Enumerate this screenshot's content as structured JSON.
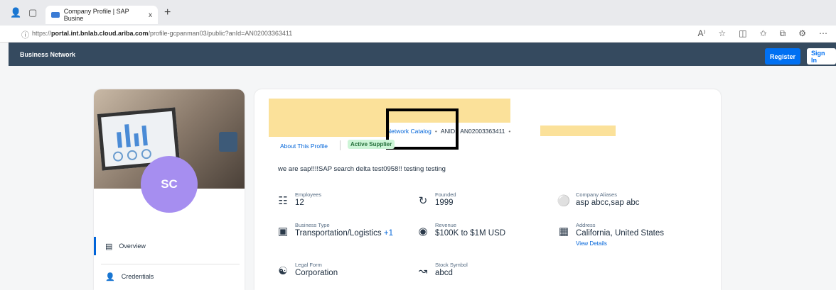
{
  "browser": {
    "tab_title": "Company Profile | SAP Busine",
    "tab_close": "x",
    "new_tab": "+",
    "url_prefix": "https://",
    "url_host": "portal.int.bnlab.cloud.ariba.com",
    "url_path": "/profile-gcpanman03/public?anId=AN02003363411",
    "icons": [
      "read-aloud-icon",
      "favorite-icon",
      "split-screen-icon",
      "favorites-bar-icon",
      "collections-icon",
      "extensions-icon",
      "more-icon"
    ]
  },
  "header": {
    "brand": "Business Network",
    "register_label": "Register",
    "signin_label": "Sign In",
    "bg_color": "#354a5f",
    "accent": "#0070f2"
  },
  "profile": {
    "avatar_initials": "SC",
    "avatar_color": "#a68ef0",
    "nav": [
      {
        "label": "Overview",
        "icon": "overview-icon",
        "active": true
      },
      {
        "label": "Credentials",
        "icon": "credentials-icon",
        "active": false
      }
    ]
  },
  "main": {
    "catalog_link": "Network Catalog",
    "anid_label": "ANID:",
    "anid_value": "AN02003363411",
    "tab_about": "About This Profile",
    "status_badge": "Active Supplier",
    "description": "we are sap!!!!SAP search delta test0958!! testing testing",
    "fields": {
      "employees": {
        "label": "Employees",
        "value": "12",
        "icon": "employees-icon"
      },
      "founded": {
        "label": "Founded",
        "value": "1999",
        "icon": "founded-icon"
      },
      "aliases": {
        "label": "Company Aliases",
        "value": "asp abcc,sap abc",
        "icon": "tag-icon"
      },
      "business_type": {
        "label": "Business Type",
        "value": "Transportation/Logistics",
        "extra": "+1",
        "icon": "business-type-icon"
      },
      "revenue": {
        "label": "Revenue",
        "value": "$100K to $1M USD",
        "icon": "revenue-icon"
      },
      "address": {
        "label": "Address",
        "value": "California, United States",
        "link": "View Details",
        "icon": "address-icon"
      },
      "legal_form": {
        "label": "Legal Form",
        "value": "Corporation",
        "icon": "legal-form-icon"
      },
      "stock_symbol": {
        "label": "Stock Symbol",
        "value": "abcd",
        "icon": "stock-symbol-icon"
      }
    }
  }
}
